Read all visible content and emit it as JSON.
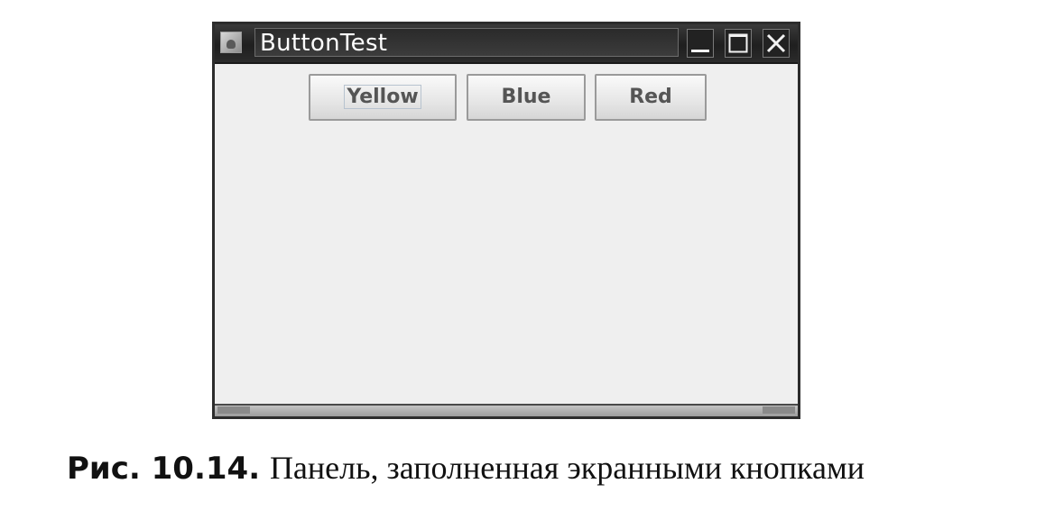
{
  "window": {
    "title": "ButtonTest",
    "controls": {
      "minimize": "minimize-icon",
      "maximize": "maximize-icon",
      "close": "close-icon"
    }
  },
  "buttons": [
    {
      "label": "Yellow",
      "focused": true
    },
    {
      "label": "Blue",
      "focused": false
    },
    {
      "label": "Red",
      "focused": false
    }
  ],
  "caption": {
    "label": "Рис. 10.14.",
    "text": "Панель, заполненная экранными кнопками"
  },
  "colors": {
    "titlebar": "#2b2b2b",
    "panel_background": "#efefef"
  }
}
